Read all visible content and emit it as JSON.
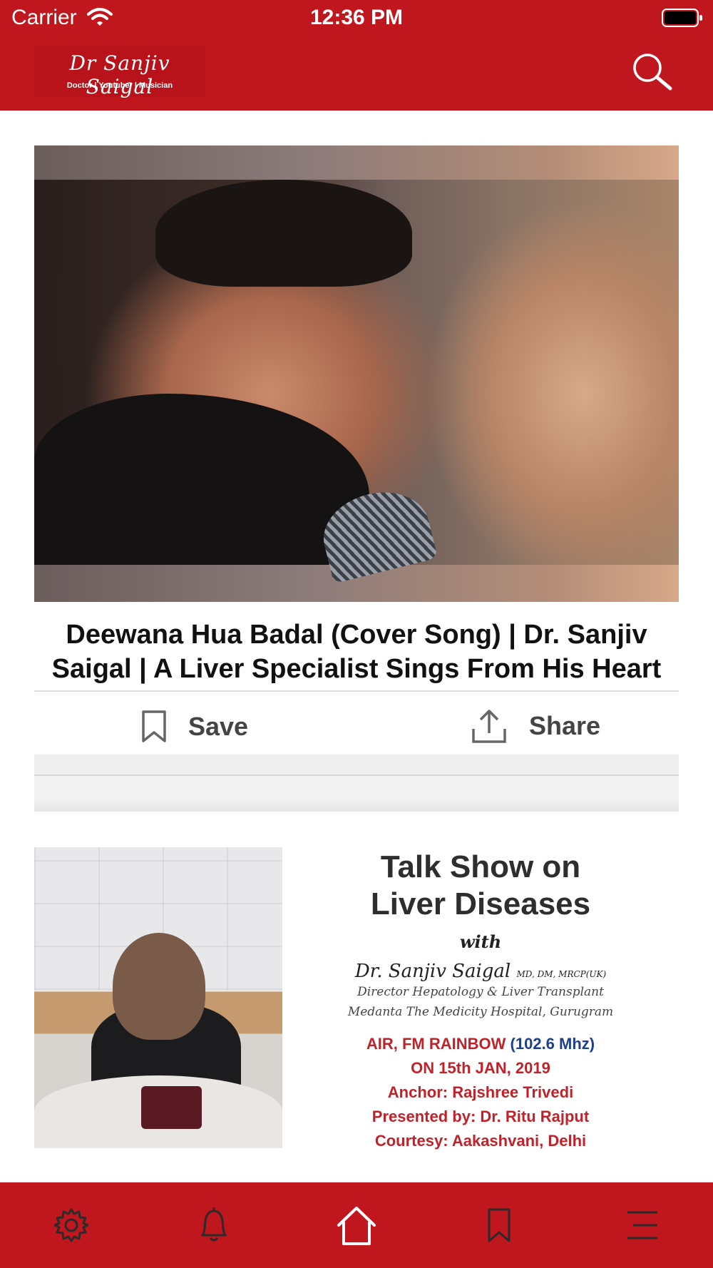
{
  "status_bar": {
    "carrier": "Carrier",
    "time": "12:36 PM"
  },
  "header": {
    "logo_name": "Dr Sanjiv Saigal",
    "logo_tagline": "Doctor | Youtuber | Musician",
    "search_icon": "search-icon"
  },
  "colors": {
    "brand_red": "#c0161d",
    "text_dark": "#111111",
    "action_gray": "#444444"
  },
  "feed": {
    "video1": {
      "title": "Deewana Hua Badal (Cover Song) | Dr. Sanjiv Saigal | A Liver Specialist Sings From His Heart",
      "save_label": "Save",
      "share_label": "Share"
    },
    "video2": {
      "poster_title_line1": "Talk Show on",
      "poster_title_line2": "Liver Diseases",
      "poster_with": "with",
      "poster_doctor": "Dr. Sanjiv Saigal",
      "poster_degrees": "MD, DM, MRCP(UK)",
      "poster_role": "Director Hepatology & Liver Transplant",
      "poster_hospital": "Medanta The Medicity Hospital, Gurugram",
      "poster_station": "AIR, FM RAINBOW",
      "poster_freq": "(102.6 Mhz)",
      "poster_date": "ON 15th JAN, 2019",
      "poster_anchor": "Anchor: Rajshree Trivedi",
      "poster_presented": "Presented by: Dr. Ritu Rajput",
      "poster_courtesy": "Courtesy: Aakashvani, Delhi"
    }
  },
  "tabbar": {
    "items": [
      "settings-icon",
      "bell-icon",
      "home-icon",
      "bookmark-icon",
      "menu-icon"
    ]
  }
}
